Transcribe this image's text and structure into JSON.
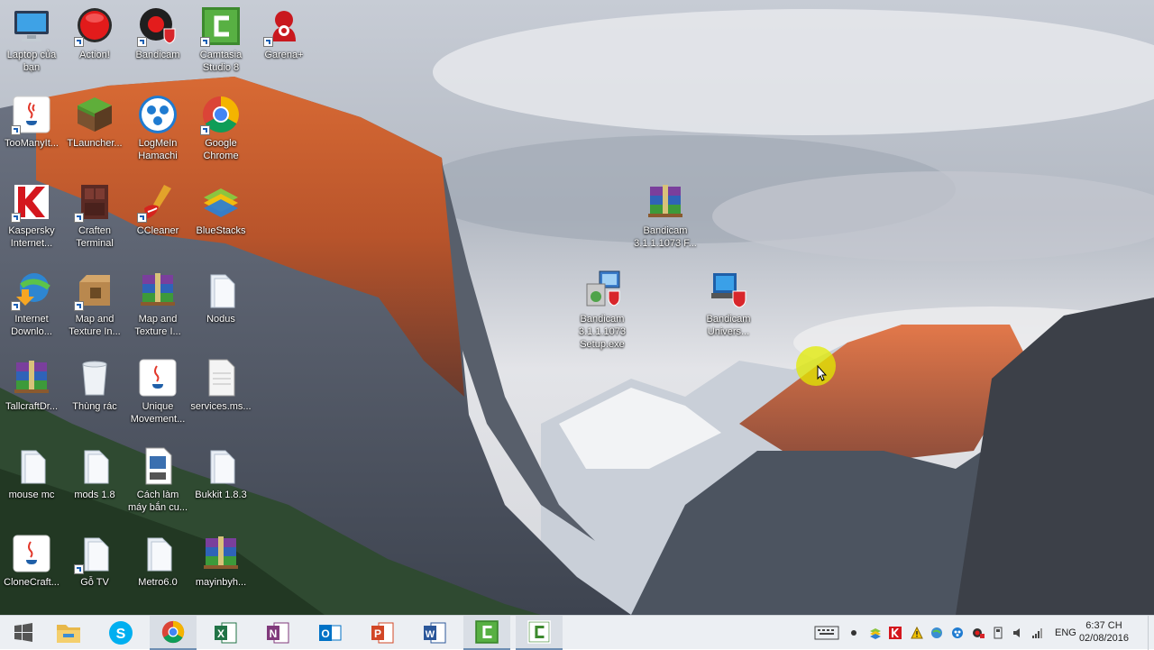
{
  "desktop": {
    "icons": [
      {
        "label": "Laptop của\nbạn",
        "icon": "computer-icon"
      },
      {
        "label": "Action!",
        "icon": "action-record-icon"
      },
      {
        "label": "Bandicam",
        "icon": "bandicam-icon"
      },
      {
        "label": "Camtasia\nStudio 8",
        "icon": "camtasia-icon"
      },
      {
        "label": "Garena+",
        "icon": "garena-icon"
      },
      {
        "label": "TooManyIt...",
        "icon": "java-icon"
      },
      {
        "label": "TLauncher...",
        "icon": "minecraft-grass-block-icon"
      },
      {
        "label": "LogMeIn\nHamachi",
        "icon": "hamachi-icon"
      },
      {
        "label": "Google\nChrome",
        "icon": "chrome-icon"
      },
      {
        "label": "Kaspersky\nInternet...",
        "icon": "kaspersky-icon"
      },
      {
        "label": "Craften\nTerminal",
        "icon": "craften-terminal-icon"
      },
      {
        "label": "CCleaner",
        "icon": "ccleaner-icon"
      },
      {
        "label": "BlueStacks",
        "icon": "bluestacks-icon"
      },
      {
        "label": "Internet\nDownlo...",
        "icon": "idm-icon"
      },
      {
        "label": "Map and\nTexture In...",
        "icon": "installer-box-icon"
      },
      {
        "label": "Map and\nTexture I...",
        "icon": "winrar-archive-icon"
      },
      {
        "label": "Nodus",
        "icon": "folder-icon"
      },
      {
        "label": "TallcraftDr...",
        "icon": "winrar-archive-icon"
      },
      {
        "label": "Thùng rác",
        "icon": "recycle-bin-icon"
      },
      {
        "label": "Unique\nMovement...",
        "icon": "java-icon"
      },
      {
        "label": "services.ms...",
        "icon": "document-icon"
      },
      {
        "label": "mouse mc",
        "icon": "folder-icon"
      },
      {
        "label": "mods 1.8",
        "icon": "folder-icon"
      },
      {
        "label": "Cách làm\nmáy bắn cu...",
        "icon": "avi-video-icon"
      },
      {
        "label": "Bukkit 1.8.3",
        "icon": "folder-icon"
      },
      {
        "label": "CloneCraft...",
        "icon": "java-icon"
      },
      {
        "label": "Gỗ TV",
        "icon": "folder-icon"
      },
      {
        "label": "Metro6.0",
        "icon": "folder-icon"
      },
      {
        "label": "mayinbyh...",
        "icon": "winrar-archive-icon"
      },
      {
        "label": "Bandicam\n3.1.1.1073 F...",
        "icon": "winrar-archive-icon"
      },
      {
        "label": "Bandicam\n3.1.1.1073\nSetup.exe",
        "icon": "setup-installer-icon"
      },
      {
        "label": "Bandicam\nUnivers...",
        "icon": "bandicam-uninstall-icon"
      }
    ]
  },
  "taskbar": {
    "apps": [
      {
        "name": "start-button",
        "icon": "windows-logo-icon"
      },
      {
        "name": "file-explorer",
        "icon": "folder-icon"
      },
      {
        "name": "skype",
        "icon": "skype-icon"
      },
      {
        "name": "chrome",
        "icon": "chrome-icon"
      },
      {
        "name": "excel",
        "icon": "excel-icon"
      },
      {
        "name": "onenote",
        "icon": "onenote-icon"
      },
      {
        "name": "outlook",
        "icon": "outlook-icon"
      },
      {
        "name": "powerpoint",
        "icon": "powerpoint-icon"
      },
      {
        "name": "word",
        "icon": "word-icon"
      },
      {
        "name": "camtasia-recorder",
        "icon": "camtasia-icon"
      },
      {
        "name": "camtasia-studio",
        "icon": "camtasia-icon"
      }
    ],
    "language": "ENG",
    "time": "6:37 CH",
    "date": "02/08/2016"
  },
  "colors": {
    "taskbar_bg": "#eceff3",
    "cursor_highlight": "#e1eb00"
  }
}
